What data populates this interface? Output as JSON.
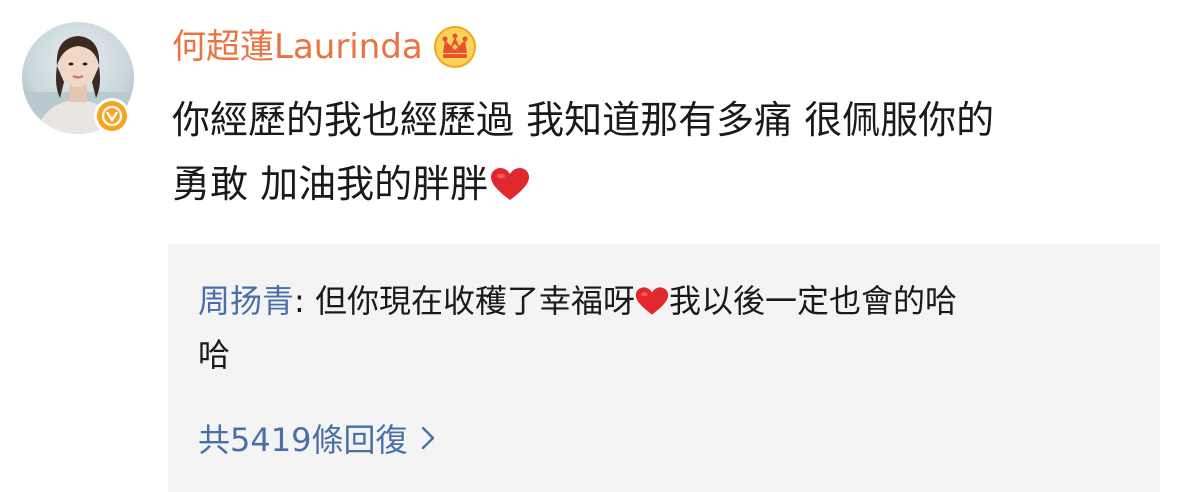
{
  "comment": {
    "username": "何超蓮Laurinda",
    "badge_icon": "verified-v-icon",
    "crown_icon": "crown-icon",
    "text_line_1": "你經歷的我也經歷過 我知道那有多痛 很佩服你的",
    "text_line_2": "勇敢 加油我的胖胖",
    "heart_icon": "red-heart-emoji",
    "username_color": "#eb7340"
  },
  "reply": {
    "username": "周扬青",
    "separator": ": ",
    "text_part_1": "但你現在收穫了幸福呀",
    "text_part_2": "我以後一定也會的哈",
    "text_line_2": "哈",
    "heart_icon": "red-heart-emoji",
    "reply_count_label": "共5419條回復",
    "chevron_icon": "chevron-right-icon",
    "link_color": "#4a6fa8"
  }
}
